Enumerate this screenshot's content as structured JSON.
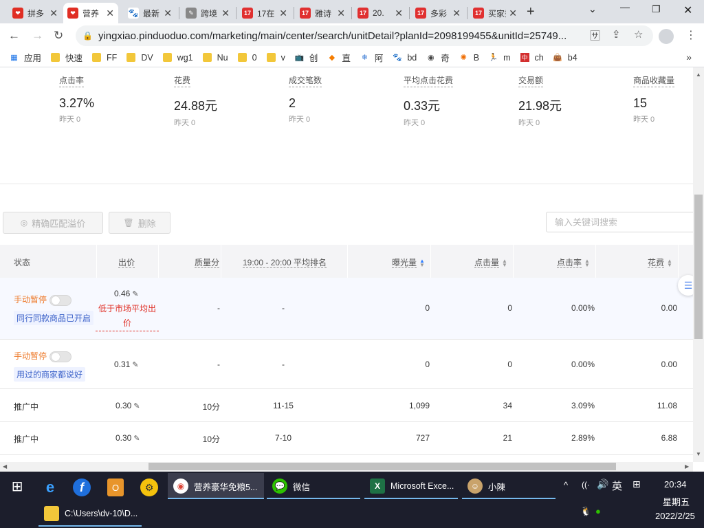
{
  "browser": {
    "tabs": [
      {
        "title": "拼多",
        "icon": "pdd-icon",
        "color": "#e02e24",
        "active": false
      },
      {
        "title": "营养",
        "icon": "pdd-icon",
        "color": "#e02e24",
        "active": true
      },
      {
        "title": "最新",
        "icon": "baidu-paw-icon",
        "color": "#2932e1",
        "active": false
      },
      {
        "title": "跨境",
        "icon": "page-icon",
        "color": "#555555",
        "active": false
      },
      {
        "title": "17在",
        "icon": "site-17-icon",
        "color": "#e03030",
        "active": false
      },
      {
        "title": "雅诗",
        "icon": "site-17-icon",
        "color": "#e03030",
        "active": false
      },
      {
        "title": "20.",
        "icon": "site-17-icon",
        "color": "#e03030",
        "active": false
      },
      {
        "title": "多彩",
        "icon": "site-17-icon",
        "color": "#e03030",
        "active": false
      },
      {
        "title": "买家秀",
        "icon": "site-17-icon",
        "color": "#e03030",
        "active": false
      }
    ],
    "url": "yingxiao.pinduoduo.com/marketing/main/center/search/unitDetail?planId=2098199455&unitId=25749...",
    "bookmarks": [
      {
        "label": "应用",
        "icon": "apps-grid-icon"
      },
      {
        "label": "快速",
        "icon": "folder-icon"
      },
      {
        "label": "FF",
        "icon": "folder-icon"
      },
      {
        "label": "DV",
        "icon": "folder-icon"
      },
      {
        "label": "wg1",
        "icon": "folder-icon"
      },
      {
        "label": "Nu",
        "icon": "folder-icon"
      },
      {
        "label": "0",
        "icon": "folder-icon"
      },
      {
        "label": "v",
        "icon": "folder-icon"
      },
      {
        "label": "创",
        "icon": "bilibili-icon"
      },
      {
        "label": "直",
        "icon": "fish-icon"
      },
      {
        "label": "阿",
        "icon": "snowflake-icon"
      },
      {
        "label": "bd",
        "icon": "baidu-paw-icon"
      },
      {
        "label": "奇",
        "icon": "globe-icon"
      },
      {
        "label": "B",
        "icon": "swirl-icon"
      },
      {
        "label": "m",
        "icon": "runner-icon"
      },
      {
        "label": "ch",
        "icon": "zhong-icon"
      },
      {
        "label": "b4",
        "icon": "bag-icon"
      }
    ]
  },
  "metrics": [
    {
      "label": "点击率",
      "value": "3.27%",
      "yesterday": "昨天 0"
    },
    {
      "label": "花费",
      "value": "24.88元",
      "yesterday": "昨天 0"
    },
    {
      "label": "成交笔数",
      "value": "2",
      "yesterday": "昨天 0"
    },
    {
      "label": "平均点击花费",
      "value": "0.33元",
      "yesterday": "昨天 0"
    },
    {
      "label": "交易额",
      "value": "21.98元",
      "yesterday": "昨天 0"
    },
    {
      "label": "商品收藏量",
      "value": "15",
      "yesterday": "昨天 0"
    }
  ],
  "actions": {
    "match_premium": "精确匹配溢价",
    "delete": "删除",
    "search_placeholder": "输入关键词搜索"
  },
  "table": {
    "headers": {
      "status": "状态",
      "bid": "出价",
      "quality": "质量分",
      "rank": "19:00 - 20:00 平均排名",
      "impressions": "曝光量",
      "clicks": "点击量",
      "ctr": "点击率",
      "cost": "花费"
    },
    "rows": [
      {
        "status": "手动暂停",
        "tag": "同行同款商品已开启",
        "bid": "0.46",
        "bid_warning": "低于市场平均出价",
        "quality": "-",
        "rank": "-",
        "impressions": "0",
        "clicks": "0",
        "ctr": "0.00%",
        "cost": "0.00"
      },
      {
        "status": "手动暂停",
        "tag": "用过的商家都说好",
        "bid": "0.31",
        "quality": "-",
        "rank": "-",
        "impressions": "0",
        "clicks": "0",
        "ctr": "0.00%",
        "cost": "0.00"
      },
      {
        "status": "推广中",
        "bid": "0.30",
        "quality": "10分",
        "rank": "11-15",
        "impressions": "1,099",
        "clicks": "34",
        "ctr": "3.09%",
        "cost": "11.08"
      },
      {
        "status": "推广中",
        "bid": "0.30",
        "quality": "10分",
        "rank": "7-10",
        "impressions": "727",
        "clicks": "21",
        "ctr": "2.89%",
        "cost": "6.88"
      }
    ]
  },
  "taskbar": {
    "items": [
      {
        "label": "营养豪华免粮5...",
        "icon": "chrome-icon"
      },
      {
        "label": "微信",
        "icon": "wechat-icon"
      },
      {
        "label": "Microsoft Exce...",
        "icon": "excel-icon"
      },
      {
        "label": "小陳",
        "icon": "avatar-icon"
      },
      {
        "label": "C:\\Users\\dv-10\\D...",
        "icon": "folder-icon"
      }
    ],
    "ime": "英",
    "time": "20:34",
    "weekday": "星期五",
    "date": "2022/2/25"
  },
  "colors": {
    "accent": "#2d7cff",
    "paused": "#ee7a2a",
    "warning": "#e02e24",
    "taskbar": "#1c1e2c"
  }
}
